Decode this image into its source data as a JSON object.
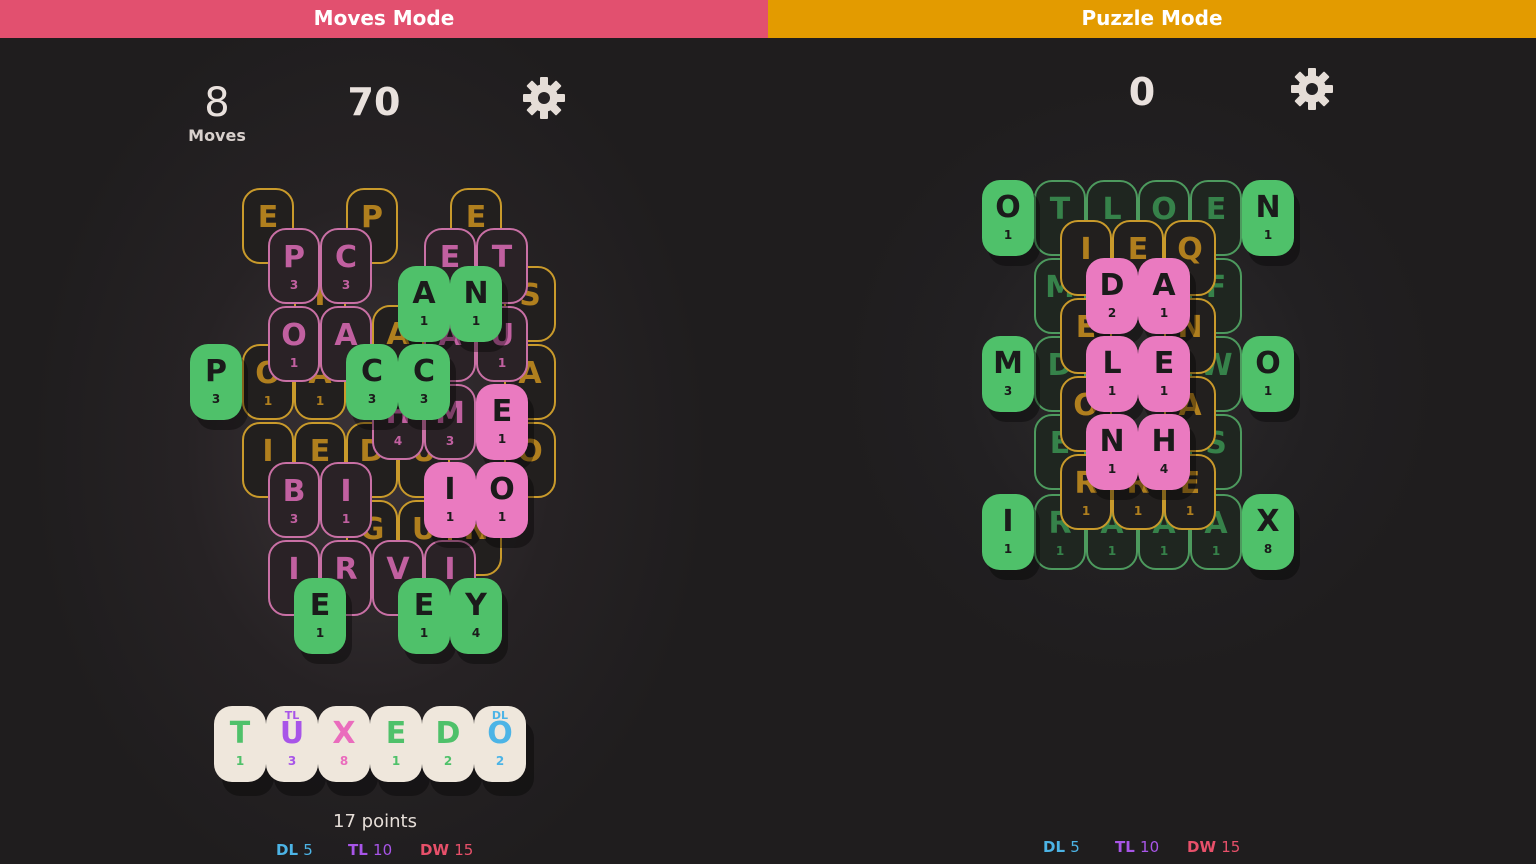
{
  "moves_mode": {
    "banner": "Moves Mode",
    "banner_color": "#e2506f",
    "moves_count": "8",
    "moves_label": "Moves",
    "score": "70",
    "settings_icon": "gear-icon",
    "rack": [
      {
        "letter": "T",
        "value": "1",
        "modifier": "",
        "color": "#4fc16a",
        "mod_color": ""
      },
      {
        "letter": "U",
        "value": "3",
        "modifier": "TL",
        "color": "#a855e8",
        "mod_color": "#a855e8"
      },
      {
        "letter": "X",
        "value": "8",
        "modifier": "",
        "color": "#ea6cbd",
        "mod_color": ""
      },
      {
        "letter": "E",
        "value": "1",
        "modifier": "",
        "color": "#4fc16a",
        "mod_color": ""
      },
      {
        "letter": "D",
        "value": "2",
        "modifier": "",
        "color": "#4fc16a",
        "mod_color": ""
      },
      {
        "letter": "O",
        "value": "2",
        "modifier": "DL",
        "color": "#4cb4e6",
        "mod_color": "#4cb4e6"
      }
    ],
    "points": "17 points",
    "legend": [
      {
        "key": "DL",
        "value": "5",
        "color": "#4cb4e6"
      },
      {
        "key": "TL",
        "value": "10",
        "color": "#a855e8"
      },
      {
        "key": "DW",
        "value": "15",
        "color": "#e8506a"
      }
    ],
    "tiles": {
      "yellow": [
        {
          "letter": "E",
          "value": ""
        },
        {
          "letter": "P",
          "value": ""
        },
        {
          "letter": "E",
          "value": ""
        },
        {
          "letter": "S",
          "value": ""
        },
        {
          "letter": "I",
          "value": ""
        },
        {
          "letter": "A",
          "value": ""
        },
        {
          "letter": "O",
          "value": "1"
        },
        {
          "letter": "A",
          "value": "1"
        },
        {
          "letter": "A",
          "value": ""
        },
        {
          "letter": "I",
          "value": ""
        },
        {
          "letter": "E",
          "value": ""
        },
        {
          "letter": "D",
          "value": ""
        },
        {
          "letter": "U",
          "value": ""
        },
        {
          "letter": "O",
          "value": ""
        },
        {
          "letter": "G",
          "value": ""
        },
        {
          "letter": "U",
          "value": ""
        },
        {
          "letter": "N",
          "value": ""
        }
      ],
      "pink_outline": [
        {
          "letter": "P",
          "value": "3"
        },
        {
          "letter": "C",
          "value": "3"
        },
        {
          "letter": "E",
          "value": ""
        },
        {
          "letter": "T",
          "value": ""
        },
        {
          "letter": "O",
          "value": "1"
        },
        {
          "letter": "A",
          "value": ""
        },
        {
          "letter": "A",
          "value": ""
        },
        {
          "letter": "U",
          "value": "1"
        },
        {
          "letter": "H",
          "value": "4"
        },
        {
          "letter": "M",
          "value": "3"
        },
        {
          "letter": "B",
          "value": "3"
        },
        {
          "letter": "I",
          "value": "1"
        },
        {
          "letter": "I",
          "value": ""
        },
        {
          "letter": "R",
          "value": ""
        },
        {
          "letter": "V",
          "value": ""
        },
        {
          "letter": "I",
          "value": ""
        }
      ],
      "green": [
        {
          "letter": "A",
          "value": "1"
        },
        {
          "letter": "N",
          "value": "1"
        },
        {
          "letter": "P",
          "value": "3"
        },
        {
          "letter": "C",
          "value": "3"
        },
        {
          "letter": "C",
          "value": "3"
        },
        {
          "letter": "E",
          "value": "1"
        },
        {
          "letter": "E",
          "value": "1"
        },
        {
          "letter": "Y",
          "value": "4"
        }
      ],
      "pink": [
        {
          "letter": "E",
          "value": "1"
        },
        {
          "letter": "I",
          "value": "1"
        },
        {
          "letter": "O",
          "value": "1"
        }
      ]
    }
  },
  "puzzle_mode": {
    "banner": "Puzzle Mode",
    "banner_color": "#e39b00",
    "score": "0",
    "settings_icon": "gear-icon",
    "legend": [
      {
        "key": "DL",
        "value": "5",
        "color": "#4cb4e6"
      },
      {
        "key": "TL",
        "value": "10",
        "color": "#a855e8"
      },
      {
        "key": "DW",
        "value": "15",
        "color": "#e8506a"
      }
    ],
    "tiles": {
      "green_solid": [
        {
          "letter": "O",
          "value": "1"
        },
        {
          "letter": "N",
          "value": "1"
        },
        {
          "letter": "M",
          "value": "3"
        },
        {
          "letter": "O",
          "value": "1"
        },
        {
          "letter": "I",
          "value": "1"
        },
        {
          "letter": "X",
          "value": "8"
        }
      ],
      "green_outline": [
        {
          "letter": "T",
          "value": ""
        },
        {
          "letter": "L",
          "value": ""
        },
        {
          "letter": "O",
          "value": ""
        },
        {
          "letter": "E",
          "value": ""
        },
        {
          "letter": "M",
          "value": ""
        },
        {
          "letter": "F",
          "value": ""
        },
        {
          "letter": "D",
          "value": ""
        },
        {
          "letter": "W",
          "value": ""
        },
        {
          "letter": "E",
          "value": ""
        },
        {
          "letter": "S",
          "value": ""
        },
        {
          "letter": "R",
          "value": "1"
        },
        {
          "letter": "A",
          "value": "1"
        },
        {
          "letter": "A",
          "value": "1"
        },
        {
          "letter": "A",
          "value": "1"
        }
      ],
      "yellow_outline": [
        {
          "letter": "I",
          "value": ""
        },
        {
          "letter": "E",
          "value": ""
        },
        {
          "letter": "Q",
          "value": ""
        },
        {
          "letter": "E",
          "value": ""
        },
        {
          "letter": "N",
          "value": ""
        },
        {
          "letter": "O",
          "value": ""
        },
        {
          "letter": "A",
          "value": ""
        },
        {
          "letter": "R",
          "value": "1"
        },
        {
          "letter": "R",
          "value": "1"
        },
        {
          "letter": "E",
          "value": "1"
        }
      ],
      "pink_solid": [
        {
          "letter": "D",
          "value": "2"
        },
        {
          "letter": "A",
          "value": "1"
        },
        {
          "letter": "L",
          "value": "1"
        },
        {
          "letter": "E",
          "value": "1"
        },
        {
          "letter": "N",
          "value": "1"
        },
        {
          "letter": "H",
          "value": "4"
        }
      ]
    }
  }
}
